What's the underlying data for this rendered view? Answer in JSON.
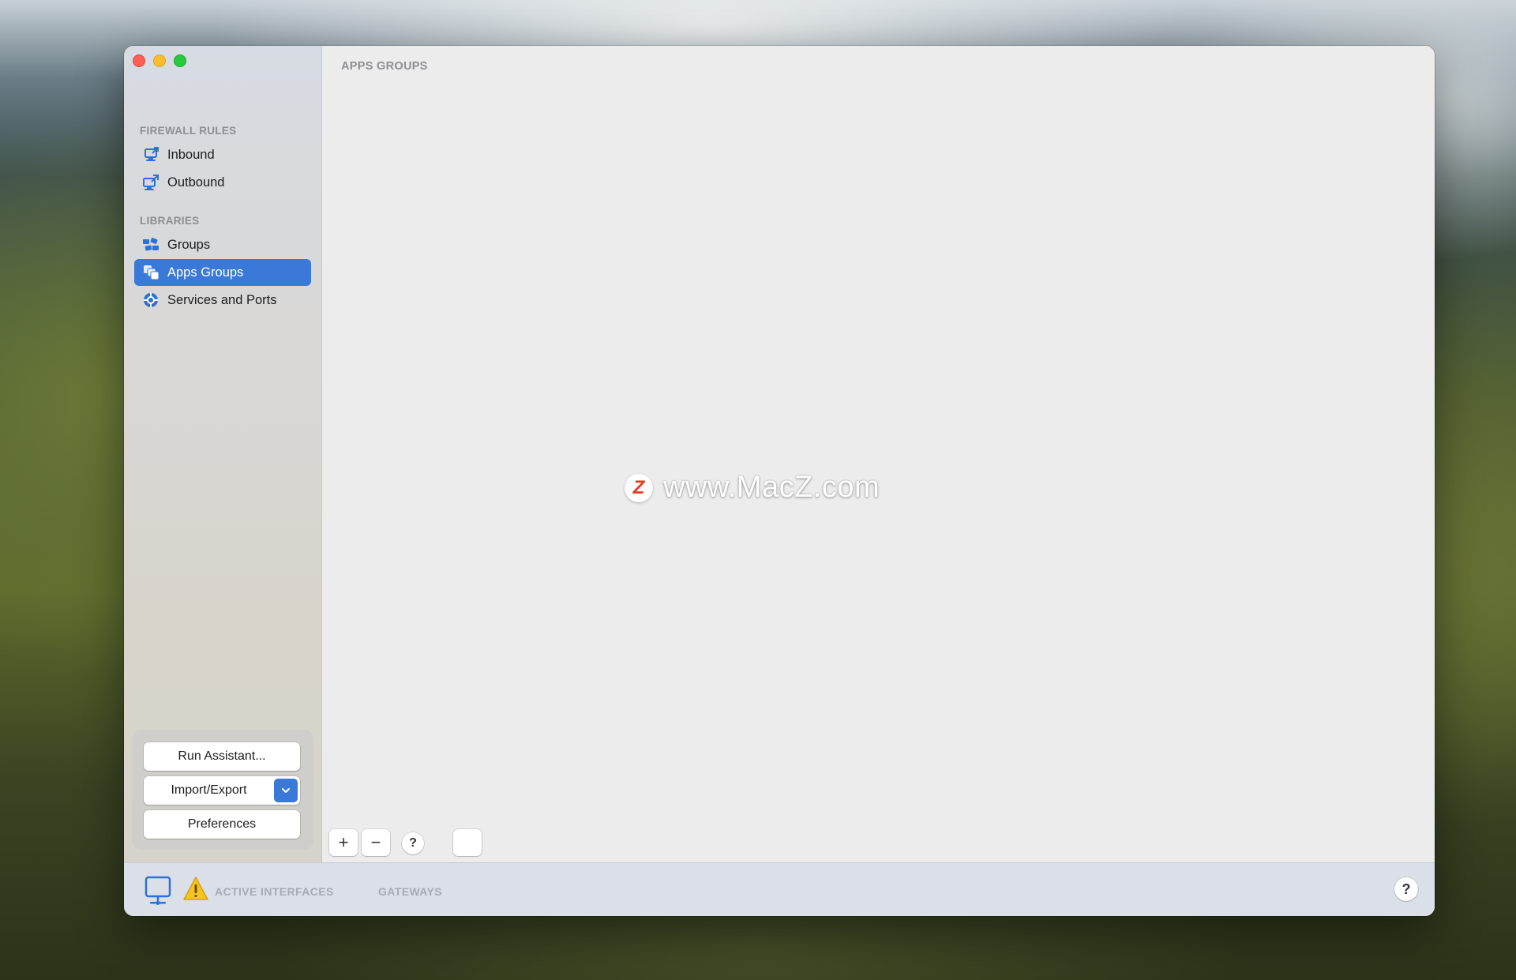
{
  "sidebar": {
    "sections": [
      {
        "title": "FIREWALL RULES",
        "items": [
          {
            "label": "Inbound",
            "icon": "inbound-icon"
          },
          {
            "label": "Outbound",
            "icon": "outbound-icon"
          }
        ]
      },
      {
        "title": "LIBRARIES",
        "items": [
          {
            "label": "Groups",
            "icon": "groups-icon"
          },
          {
            "label": "Apps Groups",
            "icon": "apps-groups-icon",
            "selected": true
          },
          {
            "label": "Services and Ports",
            "icon": "services-ports-icon"
          }
        ]
      }
    ],
    "buttons": {
      "run_assistant": "Run Assistant...",
      "import_export": "Import/Export",
      "preferences": "Preferences"
    }
  },
  "main": {
    "title": "APPS GROUPS",
    "watermark": {
      "logo": "Z",
      "text": "www.MacZ.com"
    },
    "toolbar": {
      "add": "+",
      "remove": "−",
      "help": "?"
    }
  },
  "statusbar": {
    "active_interfaces": "ACTIVE INTERFACES",
    "gateways": "GATEWAYS",
    "help": "?"
  },
  "colors": {
    "accent": "#3a79d8",
    "close": "#ff5f57",
    "minimize": "#febc2e",
    "maximize": "#28c840",
    "warning": "#f5c423"
  }
}
